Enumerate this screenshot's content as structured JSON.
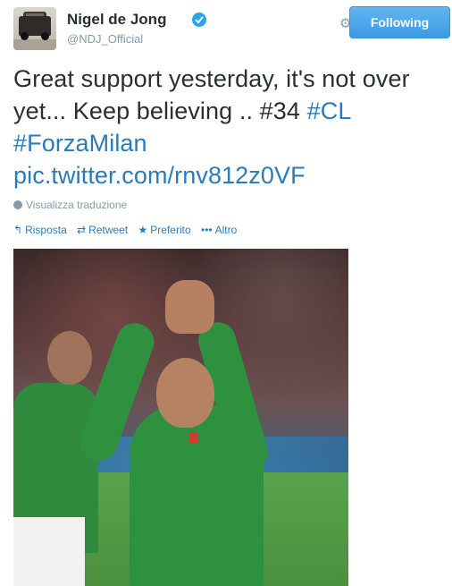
{
  "profile": {
    "name": "Nigel de Jong",
    "handle": "@NDJ_Official",
    "avatar_icon": "car-avatar-icon"
  },
  "header": {
    "settings_icon": "gear-icon",
    "follow_label": "Following",
    "follow_color": "#55acee"
  },
  "tweet": {
    "text_plain": "Great support yesterday, it's not over yet... Keep believing .. #34 ",
    "hashtag_cl": "#CL",
    "hashtag_milan": "#ForzaMilan",
    "link": "pic.twitter.com/rnv812z0VF",
    "link_color": "#2b7bb9"
  },
  "translate": {
    "label": "Visualizza traduzione",
    "icon": "globe-icon"
  },
  "actions": [
    {
      "label": "Risposta",
      "icon": "reply-icon"
    },
    {
      "label": "Retweet",
      "icon": "retweet-icon"
    },
    {
      "label": "Preferito",
      "icon": "star-icon"
    },
    {
      "label": "Altro",
      "icon": "more-icon"
    }
  ]
}
